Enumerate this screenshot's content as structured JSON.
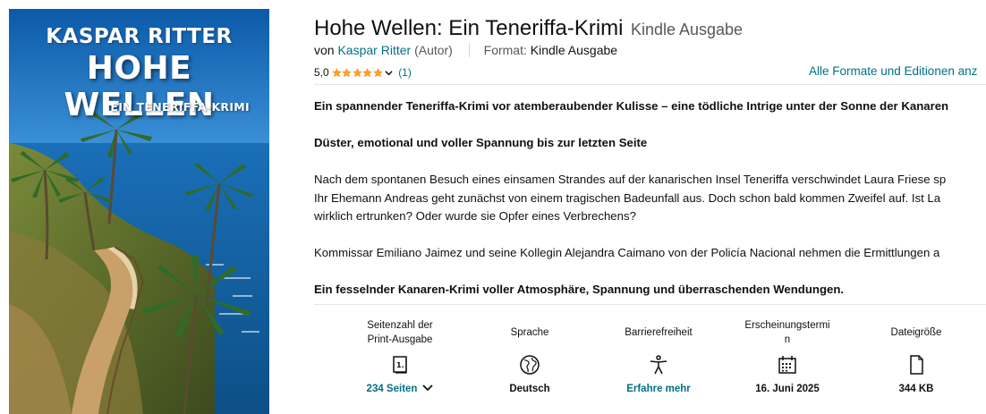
{
  "cover": {
    "author": "KASPAR RITTER",
    "title": "HOHE WELLEN",
    "subtitle": "EIN TENERIFFA-KRIMI"
  },
  "product": {
    "title": "Hohe Wellen: Ein Teneriffa-Krimi",
    "binding": "Kindle Ausgabe",
    "by_prefix": "von",
    "author": "Kaspar Ritter",
    "author_role": "(Autor)",
    "format_label": "Format:",
    "format_value": "Kindle Ausgabe",
    "rating_value": "5,0",
    "rating_stars": 5,
    "rating_count": "(1)",
    "all_formats_link": "Alle Formate und Editionen anz"
  },
  "description": {
    "headline1": "Ein spannender Teneriffa-Krimi vor atemberaubender Kulisse – eine tödliche Intrige unter der Sonne der Kanaren",
    "headline2": "Düster, emotional und voller Spannung bis zur letzten Seite",
    "para1_line1": "Nach dem spontanen Besuch eines einsamen Strandes auf der kanarischen Insel Teneriffa verschwindet Laura Friese sp",
    "para1_line2": "Ihr Ehemann Andreas geht zunächst von einem tragischen Badeunfall aus. Doch schon bald kommen Zweifel auf. Ist La",
    "para1_line3": "wirklich ertrunken? Oder wurde sie Opfer eines Verbrechens?",
    "para2": "Kommissar Emiliano Jaimez und seine Kollegin Alejandra Caimano von der Policía Nacional nehmen die Ermittlungen a",
    "headline3": "Ein fesselnder Kanaren-Krimi voller Atmosphäre, Spannung und überraschenden Wendungen."
  },
  "details": [
    {
      "label_line1": "Seitenzahl der",
      "label_line2": "Print-Ausgabe",
      "icon": "book-pages-icon",
      "value": "234 Seiten"
    },
    {
      "label_line1": "Sprache",
      "label_line2": "",
      "icon": "globe-icon",
      "value": "Deutsch"
    },
    {
      "label_line1": "Barrierefreiheit",
      "label_line2": "",
      "icon": "accessibility-icon",
      "value": "Erfahre mehr"
    },
    {
      "label_line1": "Erscheinungstermi",
      "label_line2": "n",
      "icon": "calendar-icon",
      "value": "16. Juni 2025"
    },
    {
      "label_line1": "Dateigröße",
      "label_line2": "",
      "icon": "file-icon",
      "value": "344 KB"
    }
  ],
  "colors": {
    "link": "#007185",
    "star": "#ffa41c",
    "text": "#0f1111",
    "muted": "#565959"
  }
}
